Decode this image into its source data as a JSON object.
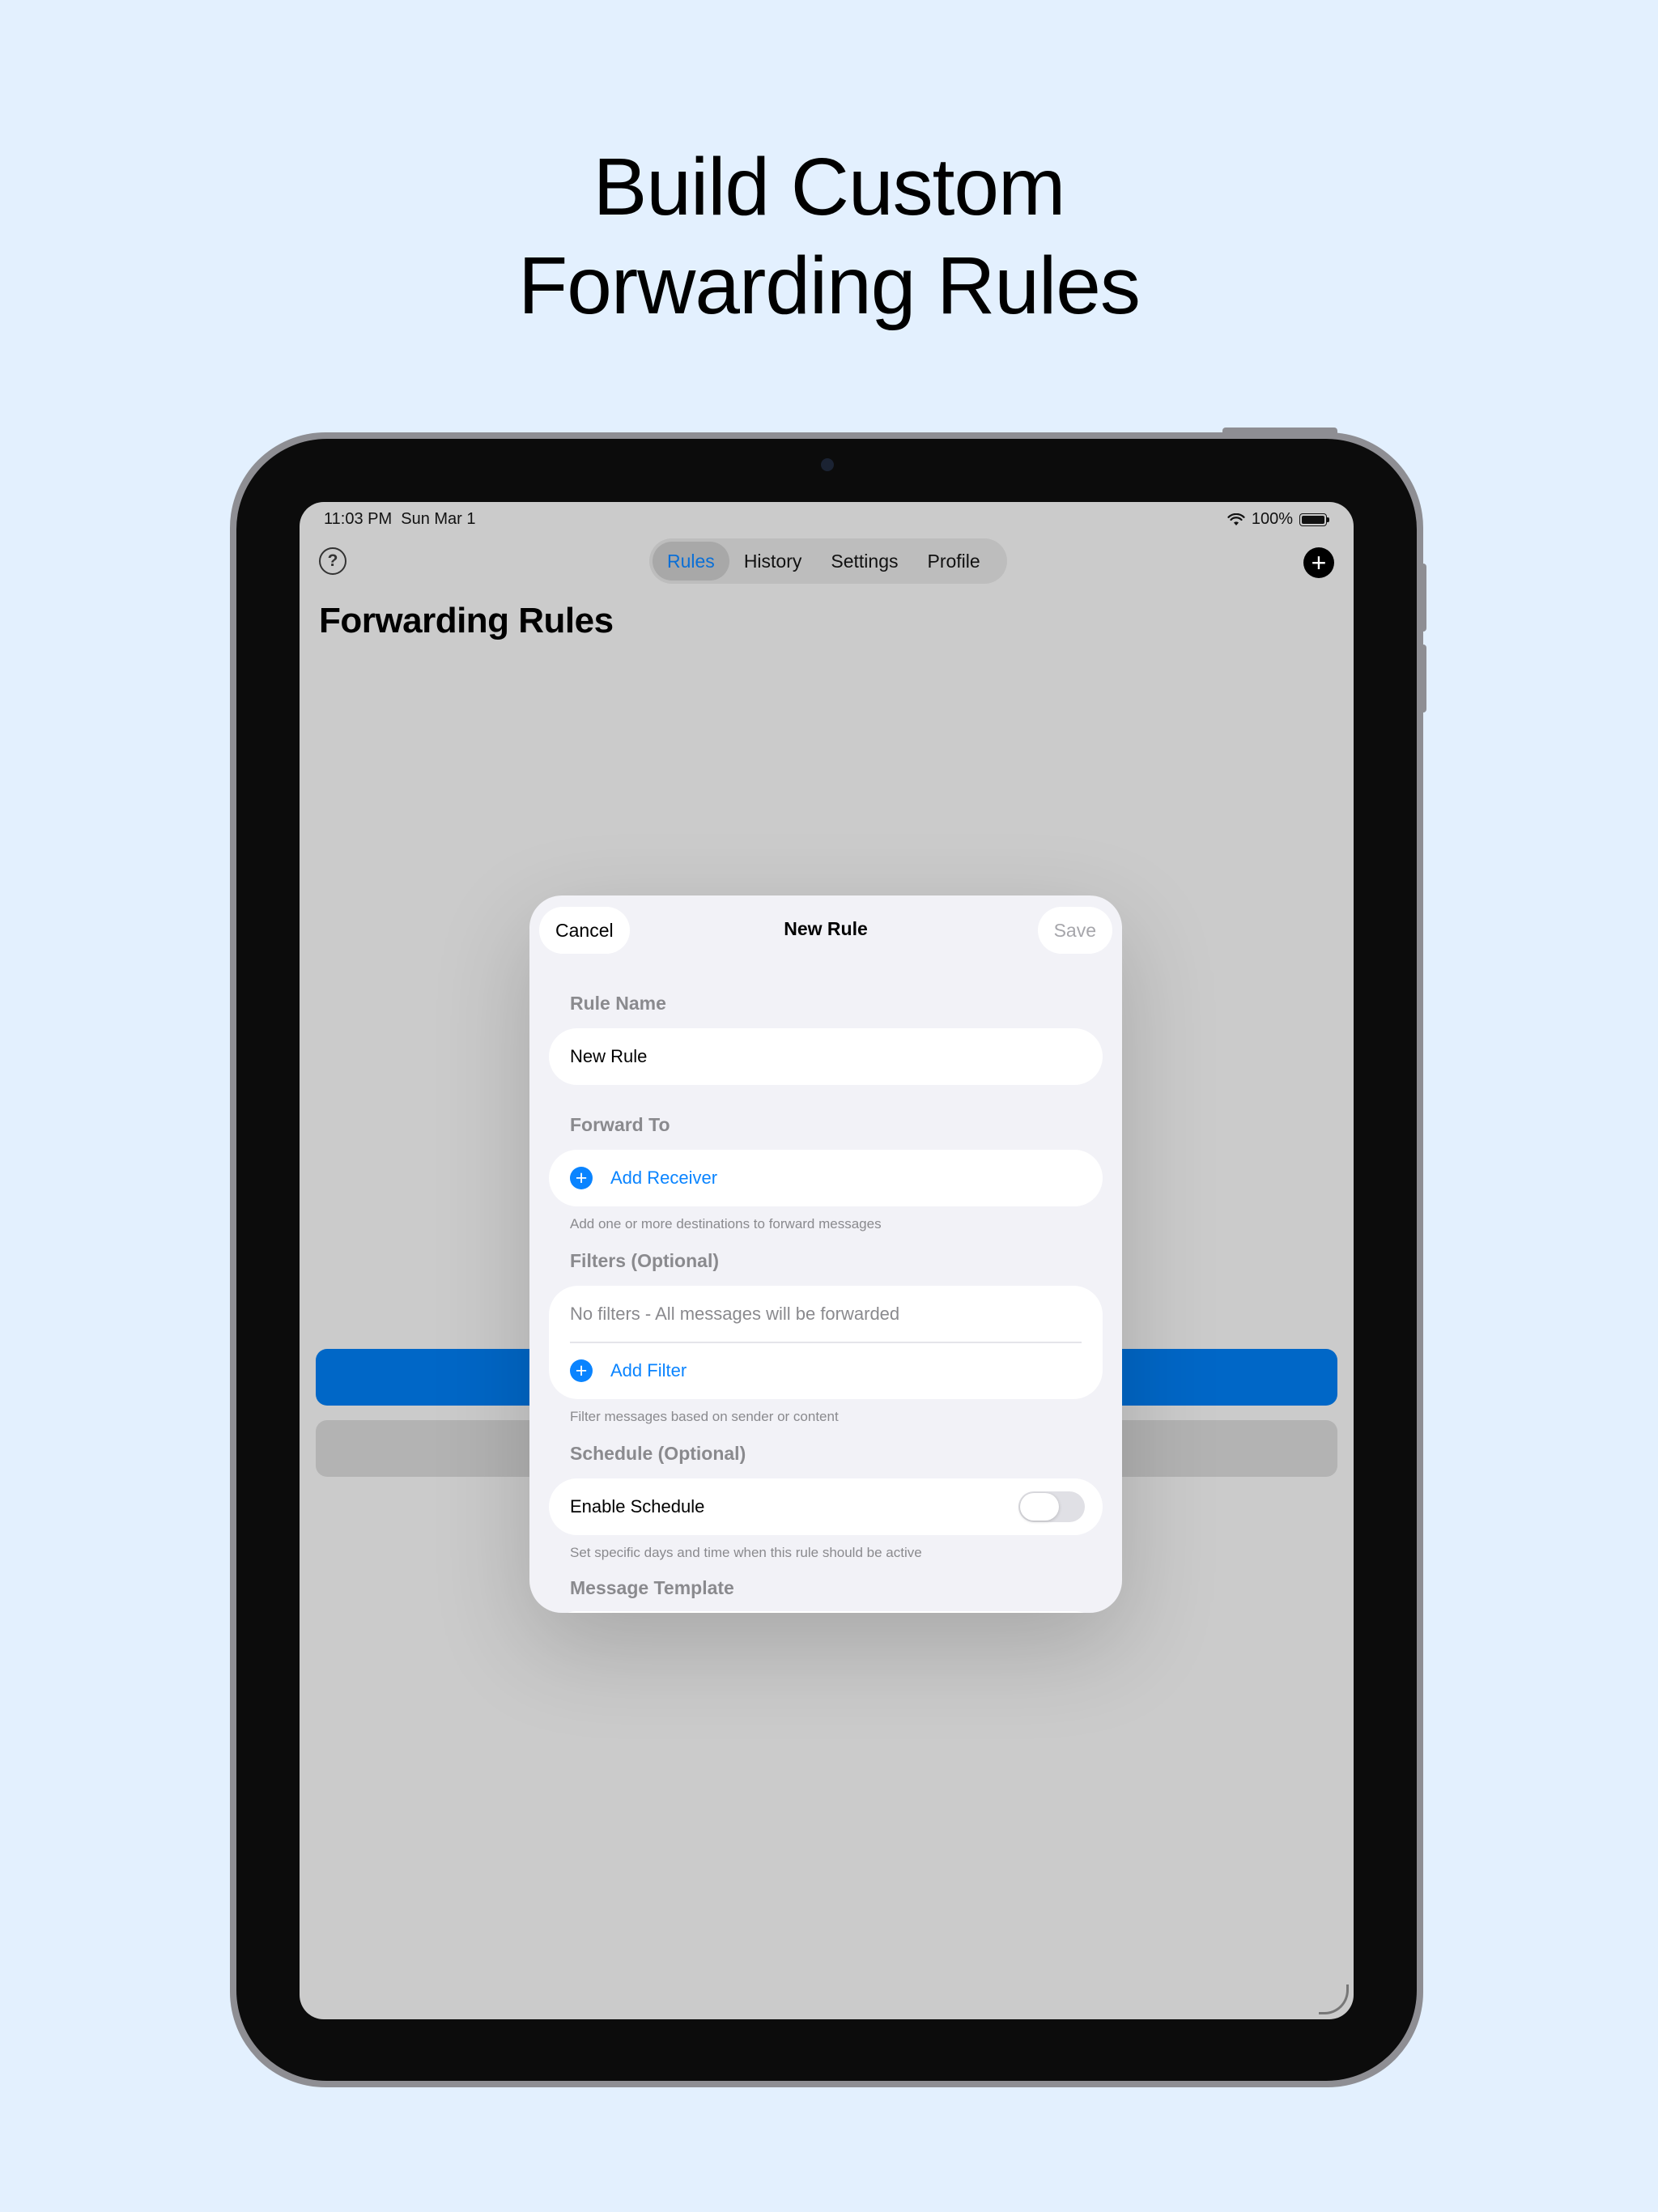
{
  "headline": {
    "line1": "Build Custom",
    "line2": "Forwarding Rules"
  },
  "status": {
    "time": "11:03 PM",
    "date": "Sun Mar 1",
    "battery": "100%"
  },
  "nav": {
    "tabs": [
      "Rules",
      "History",
      "Settings",
      "Profile"
    ],
    "active_tab": "Rules",
    "help_glyph": "?",
    "add_glyph": "+"
  },
  "page": {
    "title": "Forwarding Rules"
  },
  "modal": {
    "cancel_label": "Cancel",
    "title": "New Rule",
    "save_label": "Save",
    "rule_name": {
      "label": "Rule Name",
      "value": "New Rule"
    },
    "forward_to": {
      "label": "Forward To",
      "add_label": "Add Receiver",
      "footnote": "Add one or more destinations to forward messages"
    },
    "filters": {
      "label": "Filters (Optional)",
      "empty_text": "No filters - All messages will be forwarded",
      "add_label": "Add Filter",
      "footnote": "Filter messages based on sender or content"
    },
    "schedule": {
      "label": "Schedule (Optional)",
      "toggle_label": "Enable Schedule",
      "enabled": false,
      "footnote": "Set specific days and time when this rule should be active"
    },
    "template": {
      "label": "Message Template"
    }
  },
  "colors": {
    "accent": "#0a84ff",
    "background": "#e3f0fe",
    "primary_button": "#0067c7"
  },
  "icons": [
    "help-icon",
    "plus-icon",
    "wifi-icon",
    "battery-icon",
    "add-circle-icon"
  ]
}
